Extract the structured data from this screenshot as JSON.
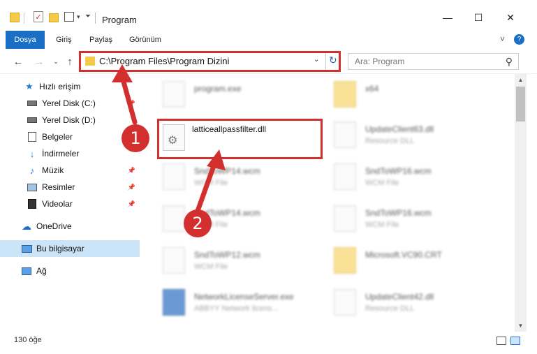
{
  "window": {
    "title": "Program",
    "minimize": "—",
    "maximize": "☐",
    "close": "✕"
  },
  "ribbon": {
    "tabs": [
      "Dosya",
      "Giriş",
      "Paylaş",
      "Görünüm"
    ],
    "collapse_icon": "˅",
    "help_icon": "?"
  },
  "address": {
    "path": "C:\\Program Files\\Program Dizini",
    "search_placeholder": "Ara: Program"
  },
  "sidebar": {
    "items": [
      {
        "label": "Hızlı erişim",
        "icon": "star-icon"
      },
      {
        "label": "Yerel Disk (C:)",
        "icon": "drive-icon"
      },
      {
        "label": "Yerel Disk (D:)",
        "icon": "drive-icon"
      },
      {
        "label": "Belgeler",
        "icon": "documents-icon"
      },
      {
        "label": "İndirmeler",
        "icon": "downloads-icon"
      },
      {
        "label": "Müzik",
        "icon": "music-icon"
      },
      {
        "label": "Resimler",
        "icon": "pictures-icon"
      },
      {
        "label": "Videolar",
        "icon": "videos-icon"
      },
      {
        "label": "OneDrive",
        "icon": "cloud-icon"
      },
      {
        "label": "Bu bilgisayar",
        "icon": "computer-icon"
      },
      {
        "label": "Ağ",
        "icon": "network-icon"
      }
    ],
    "selected": "Bu bilgisayar"
  },
  "files": [
    {
      "name": "program.exe",
      "type": ""
    },
    {
      "name": "x64",
      "type": ""
    },
    {
      "name": "latticeallpassfilter.dll",
      "type": ""
    },
    {
      "name": "UpdateClient63.dll",
      "type": "Resource DLL"
    },
    {
      "name": "SndToWP14.wcm",
      "type": "WCM File"
    },
    {
      "name": "SndToWP16.wcm",
      "type": "WCM File"
    },
    {
      "name": "SndToWP14.wcm",
      "type": "WCM File"
    },
    {
      "name": "SndToWP16.wcm",
      "type": "WCM File"
    },
    {
      "name": "SndToWP12.wcm",
      "type": "WCM File"
    },
    {
      "name": "Microsoft.VC90.CRT",
      "type": ""
    },
    {
      "name": "NetworkLicenseServer.exe",
      "type": "ABBYY Network licens..."
    },
    {
      "name": "UpdateClient42.dll",
      "type": "Resource DLL"
    }
  ],
  "status": {
    "item_count": "130 öğe"
  },
  "annotations": {
    "badge1": "1",
    "badge2": "2",
    "color": "#d32f2f"
  }
}
